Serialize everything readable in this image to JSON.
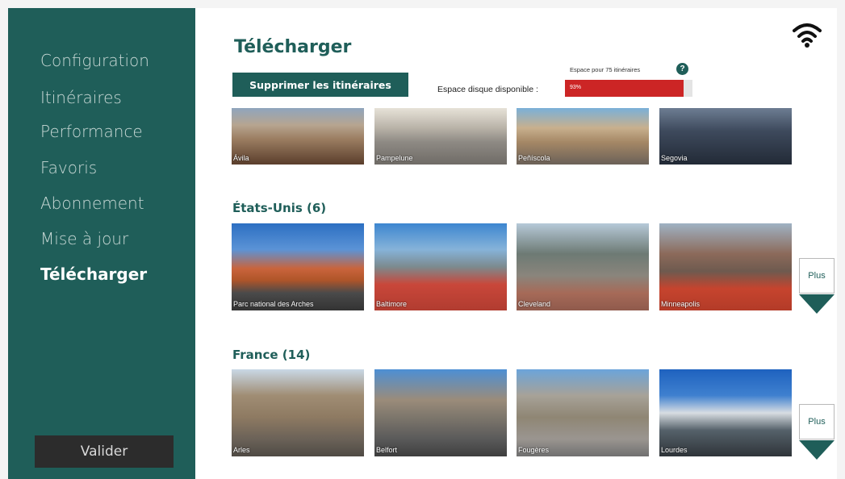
{
  "sidebar": {
    "items": [
      {
        "label": "Configuration",
        "active": false
      },
      {
        "label": "Itinéraires",
        "active": false
      },
      {
        "label": "Performance",
        "active": false
      },
      {
        "label": "Favoris",
        "active": false
      },
      {
        "label": "Abonnement",
        "active": false
      },
      {
        "label": "Mise à jour",
        "active": false
      },
      {
        "label": "Télécharger",
        "active": true
      }
    ],
    "validate_label": "Valider"
  },
  "header": {
    "title": "Télécharger",
    "delete_button": "Supprimer les itinéraires",
    "space_for_routes": "Espace pour 75 itinéraires",
    "help_icon_glyph": "?",
    "disk_label": "Espace disque disponible :",
    "disk_percent_text": "93%",
    "disk_fill_fraction": 0.93,
    "wifi_icon": "wifi-icon"
  },
  "sections": [
    {
      "title": "",
      "has_more": false,
      "routes": [
        "Ávila",
        "Pampelune",
        "Peñíscola",
        "Segovia"
      ]
    },
    {
      "title": "États-Unis (6)",
      "has_more": true,
      "more_label": "Plus",
      "routes": [
        "Parc national des Arches",
        "Baltimore",
        "Cleveland",
        "Minneapolis"
      ]
    },
    {
      "title": "France (14)",
      "has_more": true,
      "more_label": "Plus",
      "routes": [
        "Arles",
        "Belfort",
        "Fougères",
        "Lourdes"
      ]
    }
  ],
  "colors": {
    "accent": "#1f5e59",
    "disk_fill": "#cc2525",
    "validate_bg": "#2c2c2c"
  }
}
